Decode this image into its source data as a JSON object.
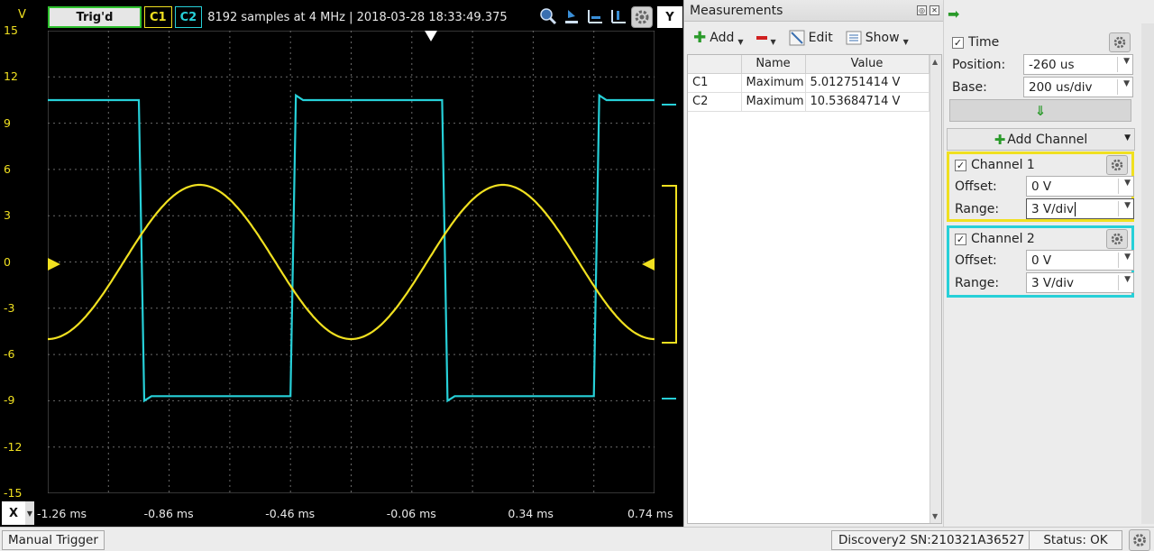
{
  "scope": {
    "y_unit": "V",
    "y_ticks": [
      "15",
      "12",
      "9",
      "6",
      "3",
      "0",
      "-3",
      "-6",
      "-9",
      "-12",
      "-15"
    ],
    "trig_status": "Trig'd",
    "c1_tag": "C1",
    "c2_tag": "C2",
    "acq_info": "8192 samples at 4 MHz | 2018-03-28 18:33:49.375",
    "y_button": "Y",
    "x_button": "X",
    "x_ticks": [
      "-1.26 ms",
      "-0.86 ms",
      "-0.46 ms",
      "-0.06 ms",
      "0.34 ms",
      "0.74 ms"
    ],
    "c1_color": "#f0e020",
    "c2_color": "#27d0d8"
  },
  "chart_data": {
    "type": "line",
    "xlabel": "",
    "ylabel": "V",
    "x_range_ms": [
      -1.26,
      0.74
    ],
    "ylim": [
      -15,
      15
    ],
    "series": [
      {
        "name": "C1",
        "kind": "sine",
        "amplitude": 5.0,
        "period_ms": 1.0,
        "peak_at_ms": -0.76
      },
      {
        "name": "C2",
        "kind": "square",
        "high": 10.5,
        "low": -8.7,
        "rise_at_ms": [
          -0.46,
          0.54
        ],
        "fall_at_ms": [
          -0.96,
          0.04
        ]
      }
    ]
  },
  "measurements": {
    "title": "Measurements",
    "toolbar": {
      "add": "Add",
      "edit": "Edit",
      "show": "Show"
    },
    "columns": [
      "",
      "Name",
      "Value"
    ],
    "rows": [
      [
        "C1",
        "Maximum",
        "5.012751414 V"
      ],
      [
        "C2",
        "Maximum",
        "10.53684714 V"
      ]
    ]
  },
  "right": {
    "time": {
      "label": "Time",
      "position_label": "Position:",
      "position_value": "-260 us",
      "base_label": "Base:",
      "base_value": "200 us/div"
    },
    "add_channel": "Add Channel",
    "ch1": {
      "label": "Channel 1",
      "offset_label": "Offset:",
      "offset_value": "0 V",
      "range_label": "Range:",
      "range_value": "3 V/div"
    },
    "ch2": {
      "label": "Channel 2",
      "offset_label": "Offset:",
      "offset_value": "0 V",
      "range_label": "Range:",
      "range_value": "3 V/div"
    }
  },
  "bottom": {
    "manual_trigger": "Manual Trigger",
    "device": "Discovery2 SN:210321A36527",
    "status": "Status: OK"
  }
}
